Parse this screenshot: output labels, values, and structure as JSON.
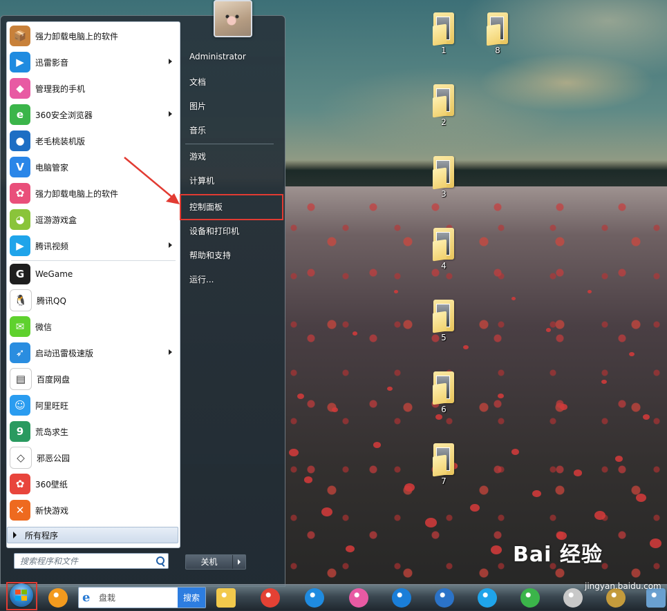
{
  "desktop": {
    "icons": [
      {
        "label": "1"
      },
      {
        "label": "8"
      },
      {
        "label": "2"
      },
      {
        "label": "3"
      },
      {
        "label": "4"
      },
      {
        "label": "5"
      },
      {
        "label": "6"
      },
      {
        "label": "7"
      }
    ]
  },
  "start_menu": {
    "pinned": [
      {
        "label": "强力卸载电脑上的软件",
        "icon": "uninstall-box-icon",
        "color": "#c8813a",
        "glyph": "📦",
        "submenu": false
      },
      {
        "label": "迅雷影音",
        "icon": "thunder-player-icon",
        "color": "#1f8be0",
        "glyph": "▶",
        "submenu": true
      },
      {
        "label": "管理我的手机",
        "icon": "phone-manager-icon",
        "color": "#e85aa3",
        "glyph": "◆",
        "submenu": false
      },
      {
        "label": "360安全浏览器",
        "icon": "360-browser-icon",
        "color": "#3bb54a",
        "glyph": "e",
        "submenu": true
      },
      {
        "label": "老毛桃装机版",
        "icon": "laomaotao-icon",
        "color": "#1d6ec4",
        "glyph": "●",
        "submenu": false
      },
      {
        "label": "电脑管家",
        "icon": "pc-manager-icon",
        "color": "#2a86e8",
        "glyph": "V",
        "submenu": false
      },
      {
        "label": "强力卸载电脑上的软件",
        "icon": "uninstall-clover-icon",
        "color": "#e94f7a",
        "glyph": "✿",
        "submenu": false
      },
      {
        "label": "逗游游戏盒",
        "icon": "douyou-icon",
        "color": "#8ac43a",
        "glyph": "◕",
        "submenu": false
      },
      {
        "label": "腾讯视频",
        "icon": "tencent-video-icon",
        "color": "#1fa4ea",
        "glyph": "▶",
        "submenu": true
      }
    ],
    "recent": [
      {
        "label": "WeGame",
        "icon": "wegame-icon",
        "color": "#1e1e1e",
        "glyph": "G",
        "submenu": false
      },
      {
        "label": "腾讯QQ",
        "icon": "qq-icon",
        "color": "#ffffff",
        "glyph": "🐧",
        "submenu": false
      },
      {
        "label": "微信",
        "icon": "wechat-icon",
        "color": "#5fd12e",
        "glyph": "✉",
        "submenu": false
      },
      {
        "label": "启动迅雷极速版",
        "icon": "thunder-speed-icon",
        "color": "#2a8de0",
        "glyph": "➶",
        "submenu": true
      },
      {
        "label": "百度网盘",
        "icon": "baidu-netdisk-icon",
        "color": "#ffffff",
        "glyph": "▤",
        "submenu": false
      },
      {
        "label": "阿里旺旺",
        "icon": "aliwangwang-icon",
        "color": "#2a9cf0",
        "glyph": "☺",
        "submenu": false
      },
      {
        "label": "荒岛求生",
        "icon": "huangdao-icon",
        "color": "#2a9a60",
        "glyph": "9",
        "submenu": false
      },
      {
        "label": "邪恶公园",
        "icon": "unity-icon",
        "color": "#ffffff",
        "glyph": "◇",
        "submenu": false
      },
      {
        "label": "360壁纸",
        "icon": "360-wallpaper-icon",
        "color": "#e8453c",
        "glyph": "✿",
        "submenu": false
      },
      {
        "label": "新快游戏",
        "icon": "xinkuai-game-icon",
        "color": "#ee6a1f",
        "glyph": "✕",
        "submenu": false
      }
    ],
    "all_programs": "所有程序",
    "search_placeholder": "搜索程序和文件",
    "right": {
      "user": "Administrator",
      "documents": "文档",
      "pictures": "图片",
      "music": "音乐",
      "games": "游戏",
      "computer": "计算机",
      "control_panel": "控制面板",
      "devices_printers": "设备和打印机",
      "help_support": "帮助和支持",
      "run": "运行..."
    },
    "shutdown": "关机"
  },
  "taskbar": {
    "search_placeholder": "盘栽",
    "search_button": "搜索",
    "apps": [
      {
        "name": "pinwheel-app-icon",
        "color": "#f39a1e"
      },
      {
        "name": "file-explorer-icon",
        "color": "#f2c94c"
      },
      {
        "name": "chrome-icon",
        "color": "#e44134"
      },
      {
        "name": "thunder-player-icon",
        "color": "#1f8be0"
      },
      {
        "name": "phone-manager-icon",
        "color": "#e85aa3"
      },
      {
        "name": "kugou-icon",
        "color": "#1a7ed8"
      },
      {
        "name": "globe-icon",
        "color": "#2b73c8"
      },
      {
        "name": "tencent-video-icon",
        "color": "#1fa4ea"
      },
      {
        "name": "360-browser-icon",
        "color": "#3bb54a"
      },
      {
        "name": "rocket-icon",
        "color": "#c8c8c8"
      },
      {
        "name": "lol-icon",
        "color": "#c49b3c"
      },
      {
        "name": "screenshot-icon",
        "color": "#6aa0d0"
      }
    ]
  },
  "watermark": {
    "brand": "Bai 经验",
    "site": "jingyan.baidu.com"
  },
  "accent": {
    "highlight_red": "#e23b32",
    "menu_blue": "#cfdcec"
  }
}
